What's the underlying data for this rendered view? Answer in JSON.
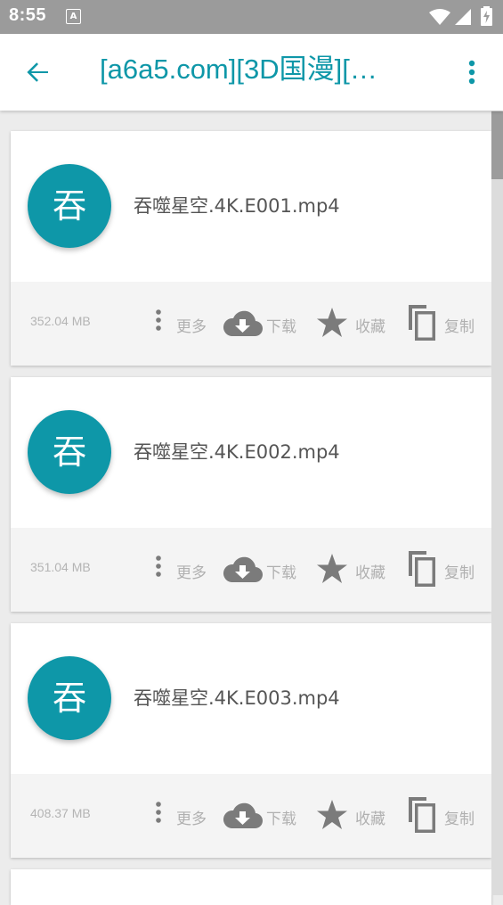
{
  "status_bar": {
    "time": "8:55",
    "notification_icon": "A"
  },
  "app_bar": {
    "back_icon": "arrow-left-icon",
    "title": "[a6a5.com][3D国漫][…",
    "overflow_icon": "more-vert-icon"
  },
  "colors": {
    "accent": "#0e97a8",
    "status_bar": "#9b9b9b",
    "icon_gray": "#7b7b7b",
    "label_gray": "#b0b0b0"
  },
  "files": [
    {
      "avatar_letter": "吞",
      "name": "吞噬星空.4K.E001.mp4",
      "size": "352.04 MB",
      "more_label": "更多",
      "download_label": "下载",
      "favorite_label": "收藏",
      "copy_label": "复制"
    },
    {
      "avatar_letter": "吞",
      "name": "吞噬星空.4K.E002.mp4",
      "size": "351.04 MB",
      "more_label": "更多",
      "download_label": "下载",
      "favorite_label": "收藏",
      "copy_label": "复制"
    },
    {
      "avatar_letter": "吞",
      "name": "吞噬星空.4K.E003.mp4",
      "size": "408.37 MB",
      "more_label": "更多",
      "download_label": "下载",
      "favorite_label": "收藏",
      "copy_label": "复制"
    }
  ]
}
